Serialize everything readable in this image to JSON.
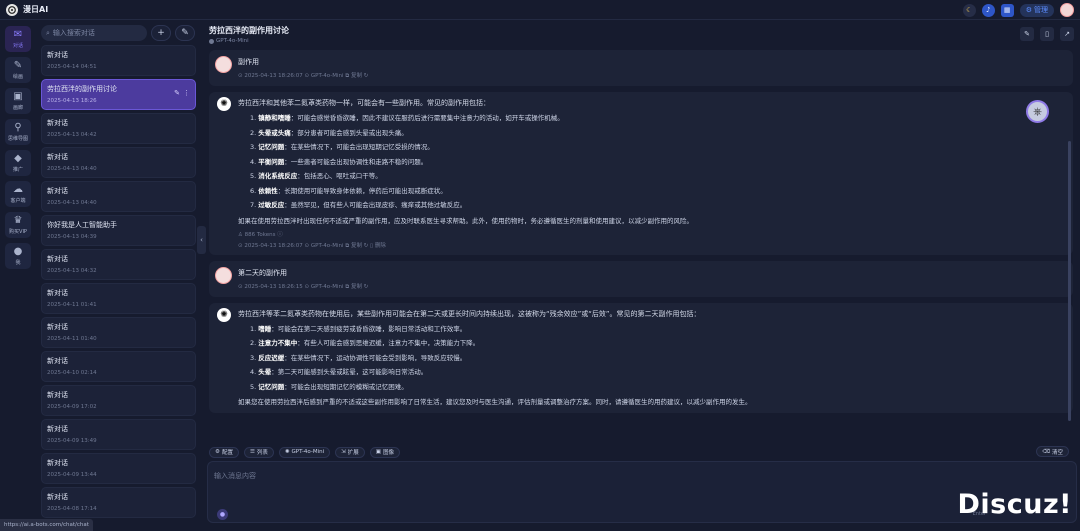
{
  "app": {
    "title": "漫日AI"
  },
  "topbar": {
    "manage_label": "管理"
  },
  "rail": [
    {
      "label": "对话",
      "icon": "chat-icon",
      "active": true
    },
    {
      "label": "绘画",
      "icon": "paint-icon",
      "active": false
    },
    {
      "label": "画廊",
      "icon": "gallery-icon",
      "active": false
    },
    {
      "label": "思维导图",
      "icon": "mindmap-icon",
      "active": false
    },
    {
      "label": "推广",
      "icon": "gem-icon",
      "active": false
    },
    {
      "label": "客户端",
      "icon": "cloud-download-icon",
      "active": false
    },
    {
      "label": "购买VIP",
      "icon": "crown-icon",
      "active": false
    },
    {
      "label": "我",
      "icon": "user-icon",
      "active": false
    }
  ],
  "sidebar": {
    "search_placeholder": "输入搜索对话",
    "conversations": [
      {
        "title": "新对话",
        "date": "2025-04-14 04:51"
      },
      {
        "title": "劳拉西泮的副作用讨论",
        "date": "2025-04-13 18:26",
        "active": true
      },
      {
        "title": "新对话",
        "date": "2025-04-13 04:42"
      },
      {
        "title": "新对话",
        "date": "2025-04-13 04:40"
      },
      {
        "title": "新对话",
        "date": "2025-04-13 04:40"
      },
      {
        "title": "你好我是人工智能助手",
        "date": "2025-04-13 04:39"
      },
      {
        "title": "新对话",
        "date": "2025-04-13 04:32"
      },
      {
        "title": "新对话",
        "date": "2025-04-11 01:41"
      },
      {
        "title": "新对话",
        "date": "2025-04-11 01:40"
      },
      {
        "title": "新对话",
        "date": "2025-04-10 02:14"
      },
      {
        "title": "新对话",
        "date": "2025-04-09 17:02"
      },
      {
        "title": "新对话",
        "date": "2025-04-09 13:49"
      },
      {
        "title": "新对话",
        "date": "2025-04-09 13:44"
      },
      {
        "title": "新对话",
        "date": "2025-04-08 17:14"
      }
    ]
  },
  "chat": {
    "title": "劳拉西泮的副作用讨论",
    "model": "GPT-4o-Mini",
    "messages": [
      {
        "role": "user",
        "text": "副作用",
        "meta": "⊙ 2025-04-13 18:26:07  ⊙ GPT-4o-Mini  ⧉ 复制  ↻"
      },
      {
        "role": "bot",
        "intro": "劳拉西泮和其他苯二氮䓬类药物一样，可能会有一些副作用。常见的副作用包括：",
        "items": [
          {
            "n": "1.",
            "b": "镇静和嗜睡",
            "t": "：可能会感觉昏昏欲睡，因此不建议在服药后进行需要集中注意力的活动，如开车或操作机械。"
          },
          {
            "n": "2.",
            "b": "头晕或头痛",
            "t": "：部分患者可能会感到头晕或出现头痛。"
          },
          {
            "n": "3.",
            "b": "记忆问题",
            "t": "：在某些情况下，可能会出现短期记忆受损的情况。"
          },
          {
            "n": "4.",
            "b": "平衡问题",
            "t": "：一些患者可能会出现协调性和走路不稳的问题。"
          },
          {
            "n": "5.",
            "b": "消化系统反应",
            "t": "：包括恶心、呕吐或口干等。"
          },
          {
            "n": "6.",
            "b": "依赖性",
            "t": "：长期使用可能导致身体依赖，停药后可能出现戒断症状。"
          },
          {
            "n": "7.",
            "b": "过敏反应",
            "t": "：虽然罕见，但有些人可能会出现皮疹、瘙痒或其他过敏反应。"
          }
        ],
        "outro": "如果在使用劳拉西泮时出现任何不适或严重的副作用，应及时联系医生寻求帮助。此外，使用药物时，务必遵循医生的剂量和使用建议，以减少副作用的风险。",
        "tokens": "♙ 886 Tokens ⓘ",
        "meta": "⊙ 2025-04-13 18:26:07  ⊙ GPT-4o-Mini  ⧉ 复制  ↻  ▯ 删除"
      },
      {
        "role": "user",
        "text": "第二天的副作用",
        "meta": "⊙ 2025-04-13 18:26:15  ⊙ GPT-4o-Mini  ⧉ 复制  ↻"
      },
      {
        "role": "bot",
        "intro": "劳拉西泮等苯二氮䓬类药物在使用后，某些副作用可能会在第二天或更长时间内持续出现，这被称为“残余效应”或“后效”。常见的第二天副作用包括：",
        "items": [
          {
            "n": "1.",
            "b": "嗜睡",
            "t": "：可能会在第二天感到疲劳或昏昏欲睡，影响日常活动和工作效率。"
          },
          {
            "n": "2.",
            "b": "注意力不集中",
            "t": "：有些人可能会感到思维迟缓，注意力不集中，决策能力下降。"
          },
          {
            "n": "3.",
            "b": "反应迟缓",
            "t": "：在某些情况下，运动协调性可能会受到影响，导致反应较慢。"
          },
          {
            "n": "4.",
            "b": "头晕",
            "t": "：第二天可能感到头晕或眩晕，这可能影响日常活动。"
          },
          {
            "n": "5.",
            "b": "记忆问题",
            "t": "：可能会出现短期记忆的模糊或记忆困难。"
          }
        ],
        "outro": "如果您在使用劳拉西泮后感到严重的不适或这些副作用影响了日常生活，建议您及时与医生沟通，评估剂量或调整治疗方案。同时，请遵循医生的用药建议，以减少副作用的发生。",
        "tokens": "",
        "meta": ""
      }
    ]
  },
  "toolbar": {
    "items": [
      {
        "icon": "gear-icon",
        "label": "配置"
      },
      {
        "icon": "list-icon",
        "label": "列表"
      },
      {
        "icon": "openai-icon",
        "label": "GPT-4o-Mini"
      },
      {
        "icon": "expand-icon",
        "label": "扩展"
      },
      {
        "icon": "image-icon",
        "label": "图像"
      }
    ],
    "clear_label": "清空"
  },
  "composer": {
    "placeholder": "输入消息内容",
    "send_hint": "Enter"
  },
  "status_url": "https://ai.a-bots.com/chat/chat",
  "watermark": "Discuz!"
}
